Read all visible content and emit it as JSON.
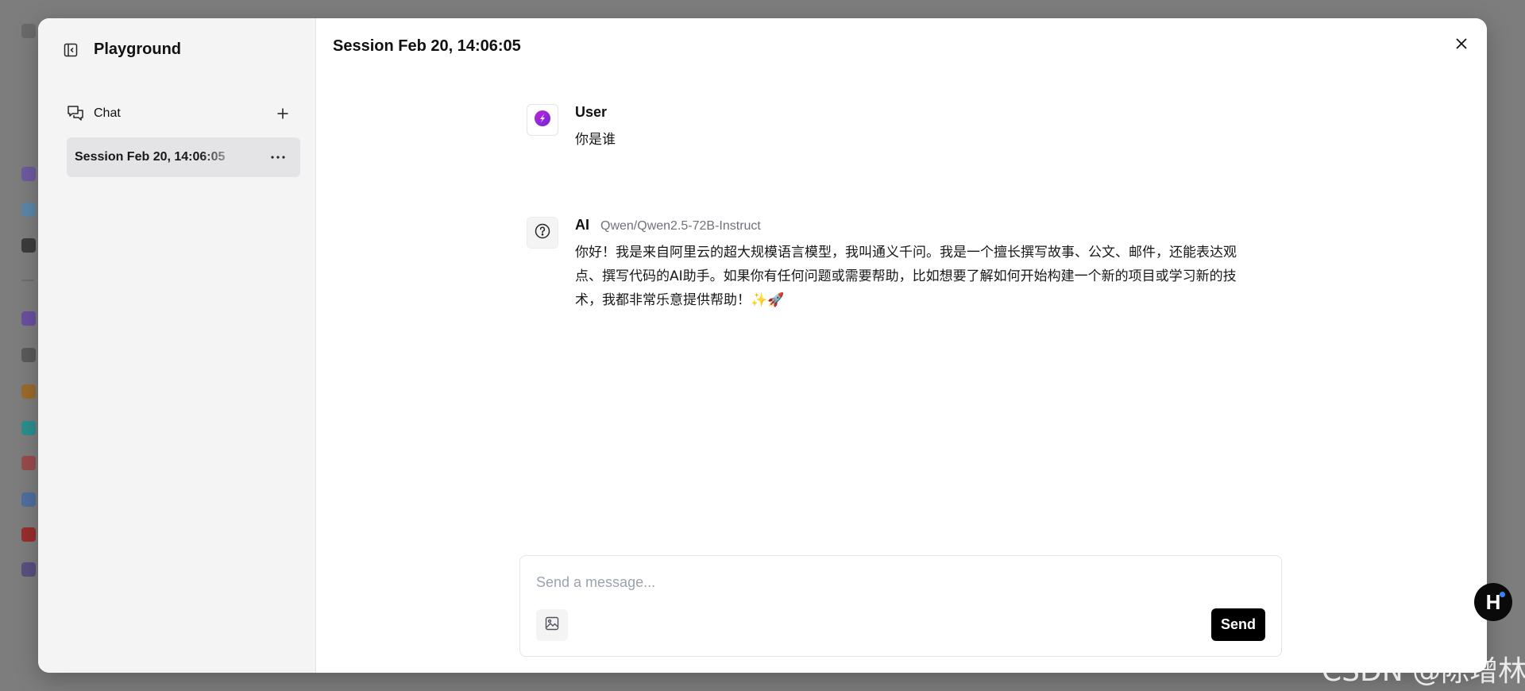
{
  "sidebar": {
    "app_title": "Playground",
    "section_label": "Chat",
    "sessions": [
      {
        "label": "Session Feb 20, 14:06:05",
        "active": true
      }
    ]
  },
  "main": {
    "session_title": "Session Feb 20, 14:06:05",
    "messages": [
      {
        "sender": "User",
        "text": "你是谁"
      },
      {
        "sender": "AI",
        "model": "Qwen/Qwen2.5-72B-Instruct",
        "lines": [
          "你好！我是来自阿里云的超大规模语言模型，我叫通义千问。我是一个擅长撰写故事、公文、邮件，还能表达观",
          "点、撰写代码的AI助手。如果你有任何问题或需要帮助，比如想要了解如何开始构建一个新的项目或学习新的技",
          "术，我都非常乐意提供帮助！✨🚀"
        ]
      }
    ]
  },
  "composer": {
    "placeholder": "Send a message...",
    "send_label": "Send"
  },
  "fab": {
    "letter": "H"
  },
  "watermark": "CSDN @陈增林",
  "icons": {
    "collapse": "sidebar-collapse-icon",
    "chat": "chat-bubbles-icon",
    "add": "plus-icon",
    "more": "more-horizontal-icon",
    "close": "close-icon",
    "user_avatar": "user-logo-icon",
    "ai_avatar": "question-circle-icon",
    "image": "image-icon"
  },
  "colors": {
    "send_button": "#000000",
    "sidebar_bg": "#f4f4f5",
    "active_session_bg": "#e4e4e7",
    "fab_dot": "#3b82f6"
  }
}
